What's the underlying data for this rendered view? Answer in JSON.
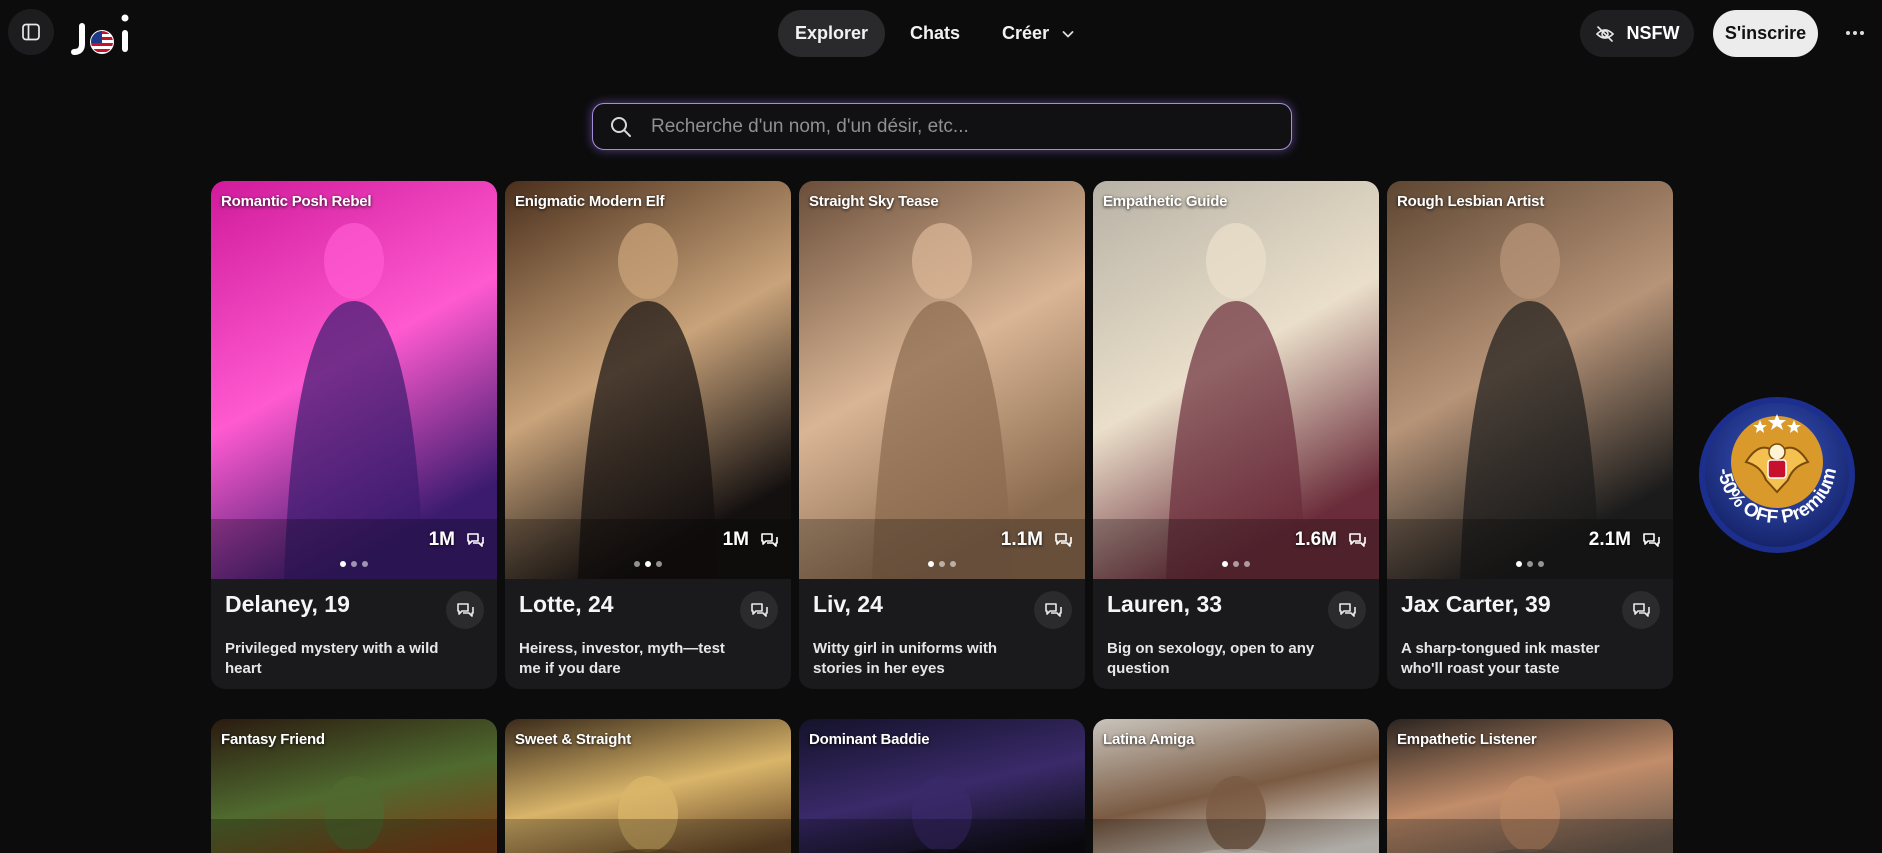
{
  "header": {
    "logo_text": "joi",
    "nav": [
      {
        "label": "Explorer",
        "active": true
      },
      {
        "label": "Chats",
        "active": false
      },
      {
        "label": "Créer",
        "active": false
      }
    ],
    "nsfw_label": "NSFW",
    "signup_label": "S'inscrire"
  },
  "search": {
    "placeholder": "Recherche d'un nom, d'un désir, etc..."
  },
  "promo": {
    "text": "-50% OFF Premium"
  },
  "cards": [
    {
      "tag": "Romantic Posh Rebel",
      "name": "Delaney, 19",
      "desc": "Privileged mystery with a wild heart",
      "count": "1M",
      "active_dot": 0,
      "colors": [
        "#d01a9b",
        "#ff5ad0",
        "#3a1b6e"
      ]
    },
    {
      "tag": "Enigmatic Modern Elf",
      "name": "Lotte, 24",
      "desc": "Heiress, investor, myth—test me if you dare",
      "count": "1M",
      "active_dot": 1,
      "colors": [
        "#4a2f1c",
        "#c9a37a",
        "#141010"
      ]
    },
    {
      "tag": "Straight Sky Tease",
      "name": "Liv, 24",
      "desc": "Witty girl in uniforms with stories in her eyes",
      "count": "1.1M",
      "active_dot": 0,
      "colors": [
        "#6a4e3a",
        "#d9b595",
        "#8a6a4e"
      ]
    },
    {
      "tag": "Empathetic Guide",
      "name": "Lauren, 33",
      "desc": "Big on sexology, open to any question",
      "count": "1.6M",
      "active_dot": 0,
      "colors": [
        "#b8b2a6",
        "#eadfca",
        "#6a2c3a"
      ]
    },
    {
      "tag": "Rough Lesbian Artist",
      "name": "Jax Carter, 39",
      "desc": "A sharp-tongued ink master who'll roast your taste",
      "count": "2.1M",
      "active_dot": 0,
      "colors": [
        "#5e4632",
        "#b79478",
        "#1b1b1b"
      ]
    },
    {
      "tag": "Fantasy Friend",
      "name": "",
      "desc": "",
      "count": "",
      "active_dot": 0,
      "colors": [
        "#2b1a10",
        "#4f6a2f",
        "#7a3f18"
      ]
    },
    {
      "tag": "Sweet & Straight",
      "name": "",
      "desc": "",
      "count": "",
      "active_dot": 0,
      "colors": [
        "#3a2a1a",
        "#d9b56a",
        "#6a4a2a"
      ]
    },
    {
      "tag": "Dominant Baddie",
      "name": "",
      "desc": "",
      "count": "",
      "active_dot": 0,
      "colors": [
        "#14122a",
        "#3a2a6a",
        "#0d0d12"
      ]
    },
    {
      "tag": "Latina Amiga",
      "name": "",
      "desc": "",
      "count": "",
      "active_dot": 0,
      "colors": [
        "#c9c4bc",
        "#7a5a42",
        "#eae6df"
      ]
    },
    {
      "tag": "Empathetic Listener",
      "name": "",
      "desc": "",
      "count": "",
      "active_dot": 0,
      "colors": [
        "#2a2420",
        "#c28d6a",
        "#6a5a4e"
      ]
    }
  ],
  "icons": {
    "sidebar": "sidebar-toggle-icon",
    "nsfw": "eye-off-icon",
    "more": "more-horizontal-icon",
    "search": "search-icon",
    "chat": "chat-bubbles-icon",
    "create_caret": "chevron-down-icon"
  }
}
